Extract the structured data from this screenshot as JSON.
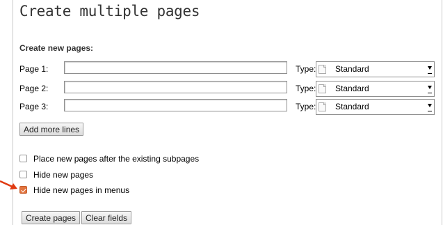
{
  "page": {
    "title": "Create multiple pages"
  },
  "form": {
    "section_title": "Create new pages:",
    "rows": [
      {
        "label": "Page 1:",
        "title_value": "",
        "type_label": "Type:",
        "type_value": "Standard"
      },
      {
        "label": "Page 2:",
        "title_value": "",
        "type_label": "Type:",
        "type_value": "Standard"
      },
      {
        "label": "Page 3:",
        "title_value": "",
        "type_label": "Type:",
        "type_value": "Standard"
      }
    ],
    "add_more_label": "Add more lines",
    "options": [
      {
        "label": "Place new pages after the existing subpages",
        "checked": false
      },
      {
        "label": "Hide new pages",
        "checked": false
      },
      {
        "label": "Hide new pages in menus",
        "checked": true
      }
    ],
    "create_label": "Create pages",
    "clear_label": "Clear fields"
  },
  "colors": {
    "accent": "#e2753f",
    "pointer_arrow": "#e03a12"
  },
  "icons": {
    "page_type": "document-icon",
    "dropdown": "chevron-down-icon",
    "pointer": "red-arrow-icon"
  }
}
